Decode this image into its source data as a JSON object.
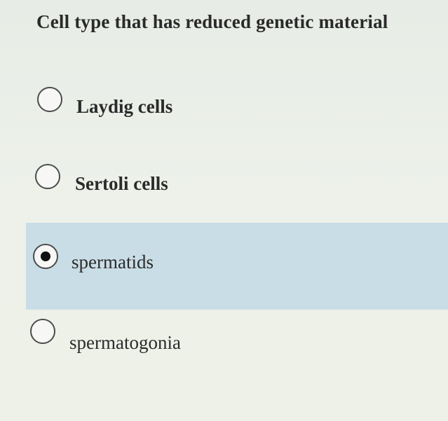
{
  "question": {
    "text": "Cell type that has reduced genetic material"
  },
  "options": [
    {
      "label": "Laydig cells",
      "selected": false
    },
    {
      "label": "Sertoli cells",
      "selected": false
    },
    {
      "label": "spermatids",
      "selected": true
    },
    {
      "label": "spermatogonia",
      "selected": false
    }
  ],
  "colors": {
    "background": "#eaeee8",
    "selected_highlight": "#c9dde6",
    "text": "#2b2b2b"
  }
}
